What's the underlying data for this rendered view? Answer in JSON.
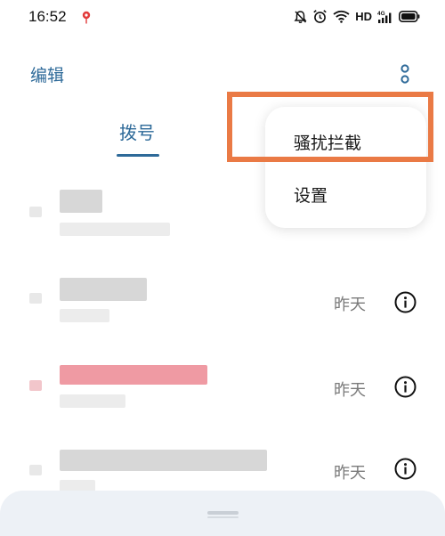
{
  "status_bar": {
    "time": "16:52",
    "network_label": "HD",
    "signal_label": "4G"
  },
  "header": {
    "edit_label": "编辑",
    "more_icon": "more-vertical-icon"
  },
  "tabs": [
    {
      "label": "拨号",
      "active": true
    }
  ],
  "popup_menu": {
    "items": [
      {
        "label": "骚扰拦截",
        "highlighted": true
      },
      {
        "label": "设置",
        "highlighted": false
      }
    ]
  },
  "call_log": [
    {
      "name": "",
      "time": "",
      "missed": false
    },
    {
      "name": "",
      "time": "昨天",
      "missed": false
    },
    {
      "name": "",
      "time": "昨天",
      "missed": true
    },
    {
      "name": "",
      "time": "昨天",
      "missed": false
    }
  ],
  "colors": {
    "accent": "#2e6a99",
    "highlight_border": "#ea7a45",
    "missed_call": "#e8858f",
    "sheet_bg": "#edf1f6"
  }
}
